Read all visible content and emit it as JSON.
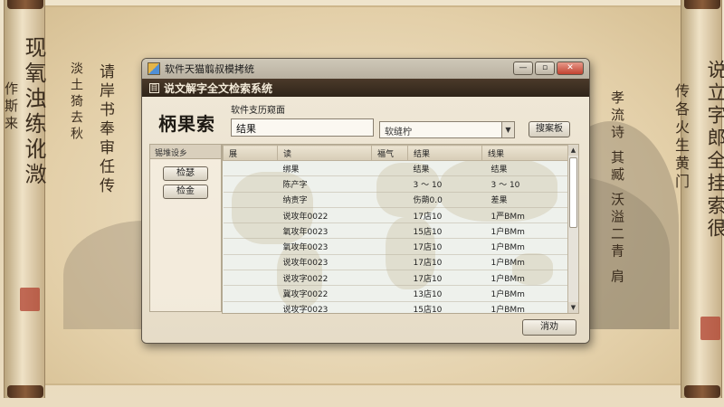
{
  "background": {
    "left_calligraphy": [
      "现氧浊练讹溦",
      "请岸书奉审任传",
      "淡土猗去秋",
      "作斯来"
    ],
    "right_calligraphy": [
      "说立字郎全挂索很",
      "传各火生黄门"
    ],
    "center_calligraphy": [
      "孝流诗 其臧 沃溢二青 肩"
    ]
  },
  "window": {
    "title": "软件天猫翦叔模拷统",
    "controls": {
      "minimize": "—",
      "maximize": "▫",
      "close": "✕"
    },
    "header_title": "说文解字全文检索系统",
    "header_icon": "目"
  },
  "search": {
    "brand": "柄果索",
    "label": "软件支历窥面",
    "input_value": "结果",
    "select_value": "软缝柠",
    "button_label": "搜案板"
  },
  "left_panel": {
    "header": "锡堆设乡",
    "buttons": [
      "检瑟",
      "检金"
    ]
  },
  "table": {
    "columns": [
      "展",
      "读",
      "福气",
      "结果",
      "线果"
    ],
    "rows": [
      [
        "",
        "绑果",
        "",
        "结果",
        "结果"
      ],
      [
        "",
        "陈产字",
        "",
        "3 ～ 10",
        "3 ～ 10"
      ],
      [
        "",
        "纳责字",
        "",
        "伤蒴0.0",
        "差果"
      ],
      [
        "",
        "说攻年0022",
        "",
        "17店10",
        "1严BMm"
      ],
      [
        "",
        "氧攻年0023",
        "",
        "15店10",
        "1户BMm"
      ],
      [
        "",
        "氧攻年0023",
        "",
        "17店10",
        "1户BMm"
      ],
      [
        "",
        "说攻年0023",
        "",
        "17店10",
        "1户BMm"
      ],
      [
        "",
        "说攻字0022",
        "",
        "17店10",
        "1户BMm"
      ],
      [
        "",
        "冀攻字0022",
        "",
        "13店10",
        "1户BMm"
      ],
      [
        "",
        "说攻字0023",
        "",
        "15店10",
        "1户BMm"
      ]
    ]
  },
  "footer": {
    "cancel_label": "消劝"
  },
  "colors": {
    "header_bar": "#3a2d20",
    "parchment": "#e9dcc2",
    "seal_red": "#b0402f"
  }
}
